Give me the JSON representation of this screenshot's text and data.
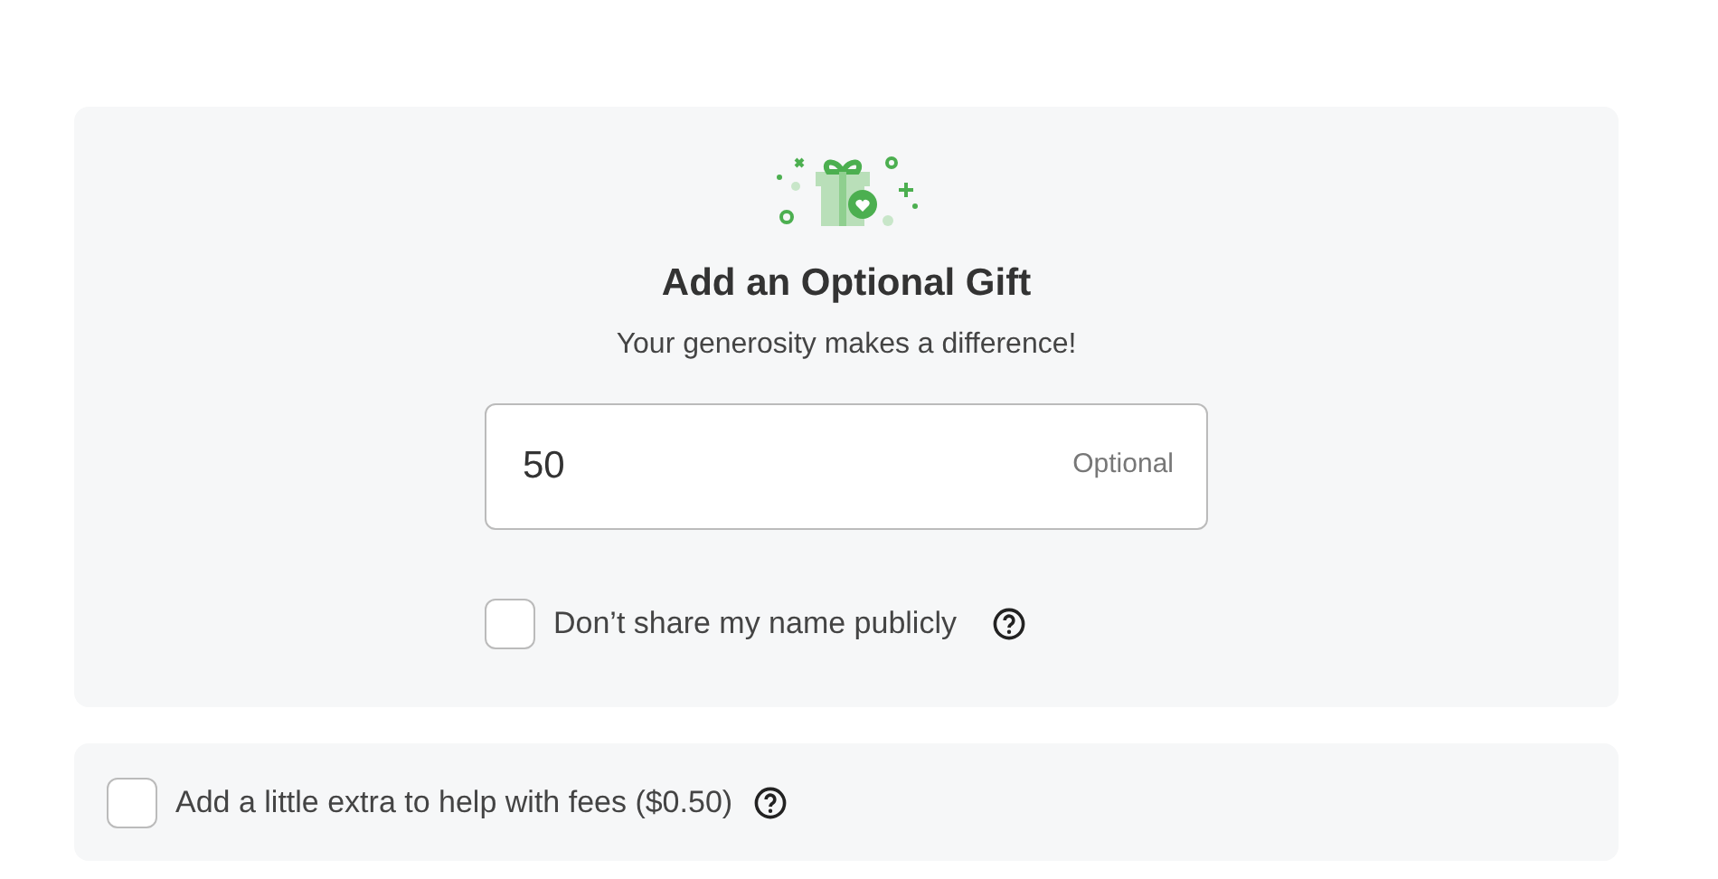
{
  "gift": {
    "title": "Add an Optional Gift",
    "subtitle": "Your generosity makes a difference!",
    "amount": {
      "value": "50",
      "hint": "Optional"
    },
    "anonymous": {
      "label": "Don’t share my name publicly",
      "checked": false
    }
  },
  "fees": {
    "label": "Add a little extra to help with fees ($0.50)",
    "checked": false
  }
}
